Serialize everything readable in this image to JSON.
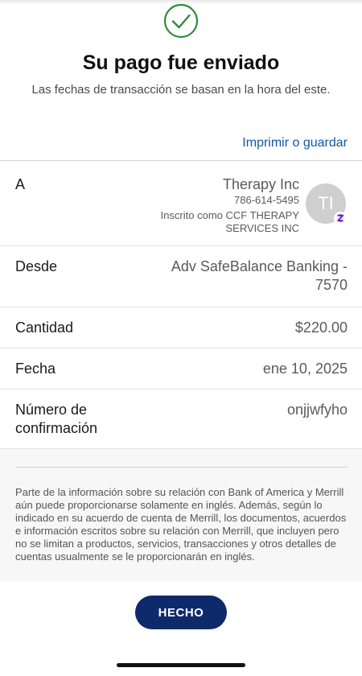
{
  "header": {
    "title": "Su pago fue enviado",
    "subtitle": "Las fechas de transacción se basan en la hora del este.",
    "print_link": "Imprimir o guardar",
    "success_icon": "check-circle-icon",
    "success_color": "#2e8b3e"
  },
  "details": {
    "to_label": "A",
    "payee_name": "Therapy Inc",
    "payee_phone": "786-614-5495",
    "payee_enrolled": "Inscrito como CCF THERAPY SERVICES INC",
    "avatar_initials": "TI",
    "zelle_icon": "zelle-icon",
    "from_label": "Desde",
    "from_value": "Adv SafeBalance Banking - 7570",
    "amount_label": "Cantidad",
    "amount_value": "$220.00",
    "date_label": "Fecha",
    "date_value": "ene 10, 2025",
    "confirmation_label": "Número de confirmación",
    "confirmation_value": "onjjwfyho"
  },
  "disclaimer": "Parte de la información sobre su relación con Bank of America y Merrill aún puede proporcionarse solamente en inglés. Además, según lo indicado en su acuerdo de cuenta de Merrill, los documentos, acuerdos e información escritos sobre su relación con Merrill, que incluyen pero no se limitan a productos, servicios, transacciones y otros detalles de cuentas usualmente se le proporcionarán en inglés.",
  "done_button": "HECHO",
  "colors": {
    "link": "#0d57a8",
    "button": "#0f2a6b",
    "zelle": "#6d1ed4"
  }
}
